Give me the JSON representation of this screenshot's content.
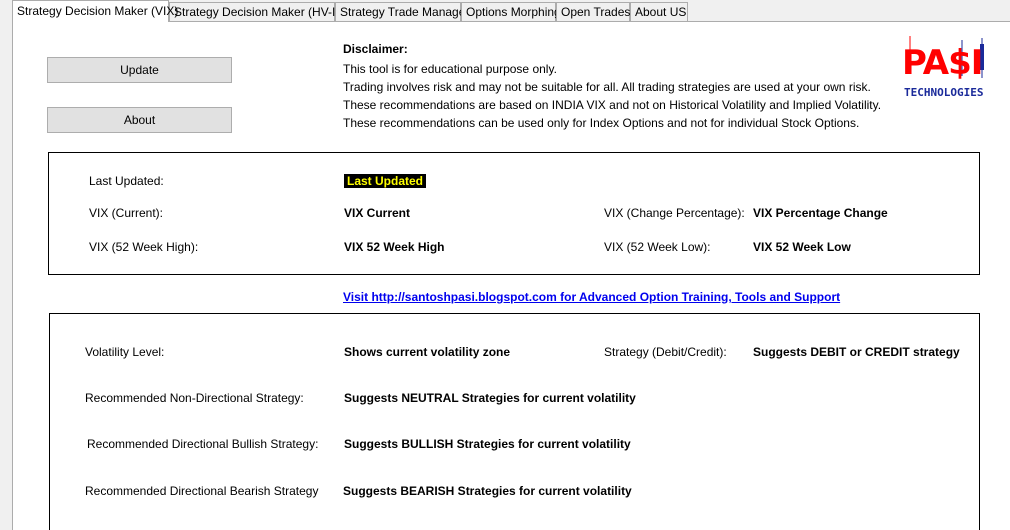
{
  "tabs": [
    "Strategy Decision Maker (VIX)",
    "Strategy Decision Maker (HV-IV)",
    "Strategy Trade Manager",
    "Options Morphing",
    "Open Trades",
    "About US"
  ],
  "buttons": {
    "update": "Update",
    "about": "About"
  },
  "disclaimer": {
    "title": "Disclaimer:",
    "lines": [
      "This tool is for educational purpose only.",
      "Trading involves risk and may not be suitable for all. All trading strategies are used at your own risk.",
      "These recommendations are based on INDIA VIX and not on Historical Volatility and Implied Volatility.",
      "These recommendations can be used only for Index Options and not for individual Stock Options."
    ]
  },
  "logo": {
    "text": "PA$I",
    "subtitle": "TECHNOLOGIES"
  },
  "vix_panel": {
    "last_updated_label": "Last Updated:",
    "last_updated_value": "Last Updated",
    "current_label": "VIX (Current):",
    "current_value": "VIX Current",
    "change_label": "VIX (Change Percentage):",
    "change_value": "VIX Percentage Change",
    "high_label": "VIX (52 Week High):",
    "high_value": "VIX 52 Week High",
    "low_label": "VIX (52 Week Low):",
    "low_value": "VIX 52 Week Low"
  },
  "link_text": "Visit http://santoshpasi.blogspot.com for Advanced Option Training, Tools and Support",
  "strategy_panel": {
    "volatility_label": "Volatility Level:",
    "volatility_value": "Shows current volatility zone",
    "debit_credit_label": "Strategy (Debit/Credit):",
    "debit_credit_value": "Suggests DEBIT or CREDIT strategy",
    "neutral_label": "Recommended Non-Directional Strategy:",
    "neutral_value": "Suggests NEUTRAL Strategies for current volatility",
    "bullish_label": "Recommended Directional Bullish Strategy:",
    "bullish_value": "Suggests BULLISH Strategies for current volatility",
    "bearish_label": "Recommended Directional Bearish Strategy",
    "bearish_value": "Suggests BEARISH Strategies for current volatility"
  },
  "colors": {
    "accent_red": "#ff0000",
    "logo_blue": "#1a2a9a",
    "highlight_bg": "#000000",
    "highlight_fg": "#ffff00",
    "link": "#0000ee"
  }
}
